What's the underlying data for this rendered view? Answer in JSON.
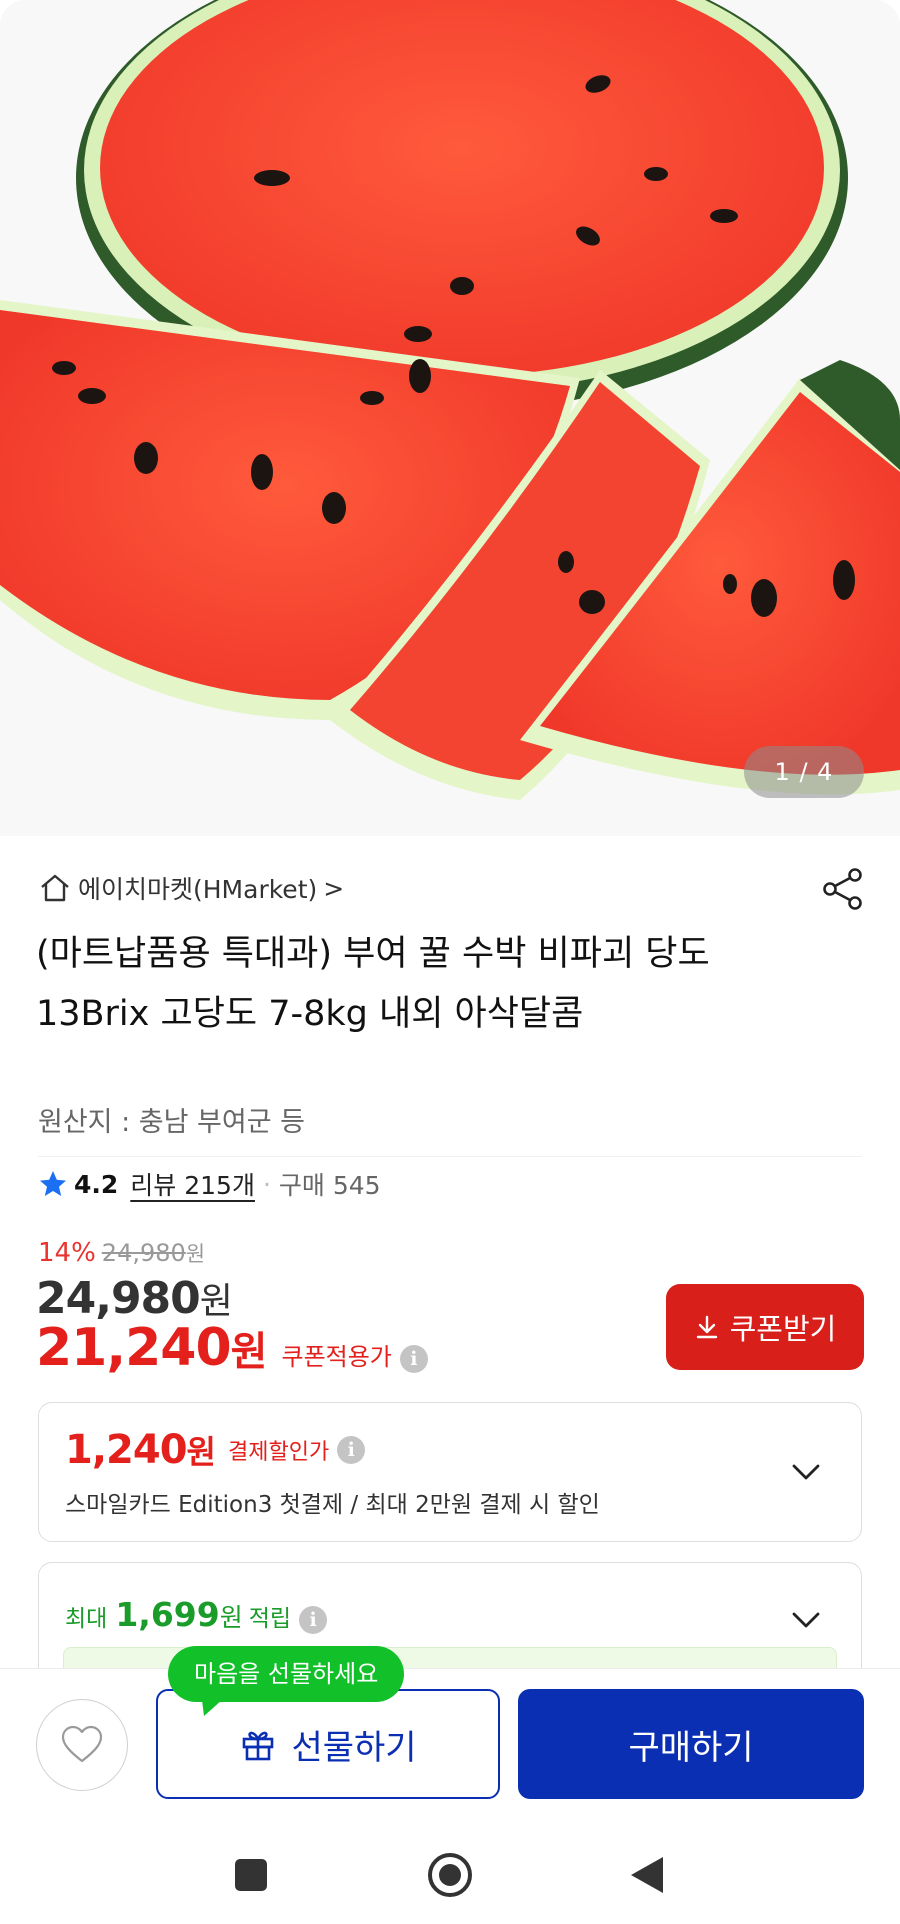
{
  "gallery": {
    "counter": "1 / 4",
    "image_subject": "watermelon"
  },
  "store": {
    "name": "에이치마켓(HMarket)",
    "chevron": ">"
  },
  "product": {
    "title": "(마트납품용 특대과) 부여 꿀 수박 비파괴 당도 13Brix 고당도 7-8kg 내외 아삭달콤",
    "origin": "원산지 : 충남 부여군 등"
  },
  "rating": {
    "score": "4.2",
    "review_text": "리뷰 215개",
    "separator": "·",
    "purchase_text": "구매 545"
  },
  "price": {
    "discount_rate": "14%",
    "original_price": "24,980",
    "original_unit": "원",
    "sale_price": "24,980",
    "sale_unit": "원",
    "coupon_price": "21,240",
    "coupon_unit": "원",
    "coupon_label": "쿠폰적용가",
    "info_glyph": "i"
  },
  "coupon_button": {
    "label": "쿠폰받기"
  },
  "payment_discount": {
    "amount": "1,240",
    "unit": "원",
    "label": "결제할인가",
    "description": "스마일카드 Edition3 첫결제 / 최대 2만원 결제 시 할인"
  },
  "points": {
    "prefix": "최대",
    "amount": "1,699",
    "unit": "원",
    "label": "적립"
  },
  "actions": {
    "gift_tooltip": "마음을 선물하세요",
    "gift_label": "선물하기",
    "buy_label": "구매하기"
  },
  "colors": {
    "accent_red": "#e3201b",
    "brand_blue": "#0a2fb2",
    "points_green": "#1a9c2a",
    "tooltip_green": "#12c12a"
  },
  "icons": [
    "home-icon",
    "share-icon",
    "star-icon",
    "info-icon",
    "download-icon",
    "chevron-down-icon",
    "heart-icon",
    "gift-icon",
    "nav-recents-icon",
    "nav-home-icon",
    "nav-back-icon"
  ]
}
